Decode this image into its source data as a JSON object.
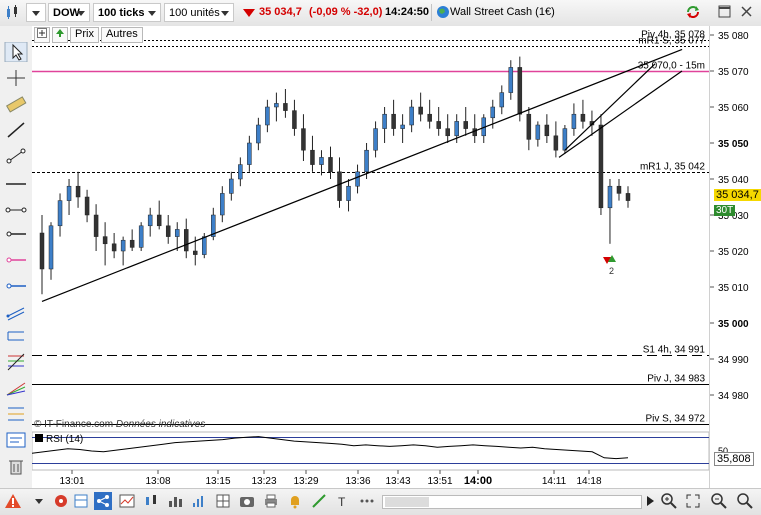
{
  "toolbar": {
    "symbol": "DOW",
    "interval": "100 ticks",
    "units": "100 unités",
    "price": "35 034,7",
    "change": "(-0,09 % -32,0)",
    "time": "14:24:50",
    "instrument": "Wall Street Cash (1€)"
  },
  "subtabs": [
    "Prix",
    "Autres"
  ],
  "colors": {
    "down": "#d40000",
    "candle_up": "#3d7fc8",
    "candle_down": "#333333",
    "pivot_pink": "#e0439a"
  },
  "chart_data": {
    "type": "candlestick",
    "y_axis_ticks": [
      "35 080",
      "35 070",
      "35 060",
      "35 050",
      "35 040",
      "35 030",
      "35 020",
      "35 010",
      "35 000",
      "34 990",
      "34 980"
    ],
    "x_axis_ticks": [
      "13:01",
      "13:08",
      "13:15",
      "13:23",
      "13:29",
      "13:36",
      "13:43",
      "13:51",
      "14:00",
      "14:11",
      "14:18"
    ],
    "ylim": [
      34975,
      35082
    ],
    "levels": [
      {
        "label": "Piv 4h, 35 078",
        "value": 35078.5,
        "style": "dashed"
      },
      {
        "label": "mR1 S, 35 077",
        "value": 35077,
        "style": "dashed"
      },
      {
        "label": "35 070,0 - 15m",
        "value": 35070,
        "style": "pink"
      },
      {
        "label": "mR1 J, 35 042",
        "value": 35042,
        "style": "dotted"
      },
      {
        "label": "S1 4h, 34 991",
        "value": 34991,
        "style": "longdash"
      },
      {
        "label": "Piv J, 34 983",
        "value": 34983,
        "style": "solid"
      },
      {
        "label": "Piv S, 34 972",
        "value": 34972,
        "style": "solid"
      }
    ],
    "last_price": "35 034,7",
    "countdown": "30T",
    "candles": [
      [
        35025,
        35030,
        35008,
        35015
      ],
      [
        35015,
        35028,
        35012,
        35027
      ],
      [
        35027,
        35036,
        35024,
        35034
      ],
      [
        35034,
        35040,
        35030,
        35038
      ],
      [
        35038,
        35042,
        35032,
        35035
      ],
      [
        35035,
        35037,
        35028,
        35030
      ],
      [
        35030,
        35033,
        35020,
        35024
      ],
      [
        35024,
        35028,
        35016,
        35022
      ],
      [
        35022,
        35025,
        35018,
        35020
      ],
      [
        35020,
        35024,
        35016,
        35023
      ],
      [
        35023,
        35026,
        35020,
        35021
      ],
      [
        35021,
        35028,
        35020,
        35027
      ],
      [
        35027,
        35032,
        35024,
        35030
      ],
      [
        35030,
        35034,
        35026,
        35027
      ],
      [
        35027,
        35030,
        35022,
        35024
      ],
      [
        35024,
        35028,
        35020,
        35026
      ],
      [
        35026,
        35029,
        35018,
        35020
      ],
      [
        35020,
        35024,
        35016,
        35019
      ],
      [
        35019,
        35025,
        35018,
        35024
      ],
      [
        35024,
        35032,
        35023,
        35030
      ],
      [
        35030,
        35038,
        35028,
        35036
      ],
      [
        35036,
        35042,
        35034,
        35040
      ],
      [
        35040,
        35046,
        35038,
        35044
      ],
      [
        35044,
        35052,
        35042,
        35050
      ],
      [
        35050,
        35057,
        35048,
        35055
      ],
      [
        35055,
        35062,
        35053,
        35060
      ],
      [
        35060,
        35064,
        35056,
        35061
      ],
      [
        35061,
        35065,
        35057,
        35059
      ],
      [
        35059,
        35062,
        35052,
        35054
      ],
      [
        35054,
        35058,
        35045,
        35048
      ],
      [
        35048,
        35052,
        35042,
        35044
      ],
      [
        35044,
        35048,
        35041,
        35046
      ],
      [
        35046,
        35049,
        35040,
        35042
      ],
      [
        35042,
        35046,
        35032,
        35034
      ],
      [
        35034,
        35040,
        35031,
        35038
      ],
      [
        35038,
        35044,
        35036,
        35042
      ],
      [
        35042,
        35050,
        35040,
        35048
      ],
      [
        35048,
        35056,
        35046,
        35054
      ],
      [
        35054,
        35060,
        35050,
        35058
      ],
      [
        35058,
        35062,
        35052,
        35054
      ],
      [
        35054,
        35058,
        35050,
        35055
      ],
      [
        35055,
        35062,
        35053,
        35060
      ],
      [
        35060,
        35064,
        35056,
        35058
      ],
      [
        35058,
        35062,
        35054,
        35056
      ],
      [
        35056,
        35060,
        35052,
        35054
      ],
      [
        35054,
        35058,
        35050,
        35052
      ],
      [
        35052,
        35058,
        35050,
        35056
      ],
      [
        35056,
        35060,
        35052,
        35054
      ],
      [
        35054,
        35058,
        35050,
        35052
      ],
      [
        35052,
        35058,
        35050,
        35057
      ],
      [
        35057,
        35062,
        35054,
        35060
      ],
      [
        35060,
        35066,
        35058,
        35064
      ],
      [
        35064,
        35073,
        35062,
        35071
      ],
      [
        35071,
        35074,
        35056,
        35058
      ],
      [
        35058,
        35060,
        35048,
        35051
      ],
      [
        35051,
        35056,
        35049,
        35055
      ],
      [
        35055,
        35058,
        35050,
        35052
      ],
      [
        35052,
        35056,
        35046,
        35048
      ],
      [
        35048,
        35055,
        35047,
        35054
      ],
      [
        35054,
        35061,
        35052,
        35058
      ],
      [
        35058,
        35062,
        35054,
        35056
      ],
      [
        35056,
        35059,
        35052,
        35055
      ],
      [
        35055,
        35058,
        35030,
        35032
      ],
      [
        35032,
        35040,
        35022,
        35038
      ],
      [
        35038,
        35040,
        35034,
        35036
      ],
      [
        35036,
        35038,
        35032,
        35034
      ]
    ],
    "trendlines": [
      {
        "from": [
          0,
          35006
        ],
        "to": [
          71,
          35076
        ]
      },
      {
        "from": [
          58,
          35048
        ],
        "to": [
          68,
          35072
        ]
      }
    ]
  },
  "rsi": {
    "label": "RSI (14)",
    "value": "35,808",
    "level_top": "50",
    "values": [
      42,
      44,
      46,
      48,
      47,
      45,
      44,
      46,
      48,
      50,
      52,
      54,
      56,
      57,
      58,
      59,
      60,
      62,
      63,
      64,
      62,
      60,
      58,
      57,
      56,
      55,
      54,
      52,
      53,
      52,
      51,
      52,
      53,
      52,
      50,
      51,
      52,
      53,
      52,
      51,
      50,
      49,
      50,
      48,
      47,
      46,
      45,
      44,
      36,
      35,
      36
    ]
  },
  "overlays": {
    "signal_count": "2",
    "copyright": "© IT-Finance.com",
    "disclaimer": "Données indicatives"
  }
}
